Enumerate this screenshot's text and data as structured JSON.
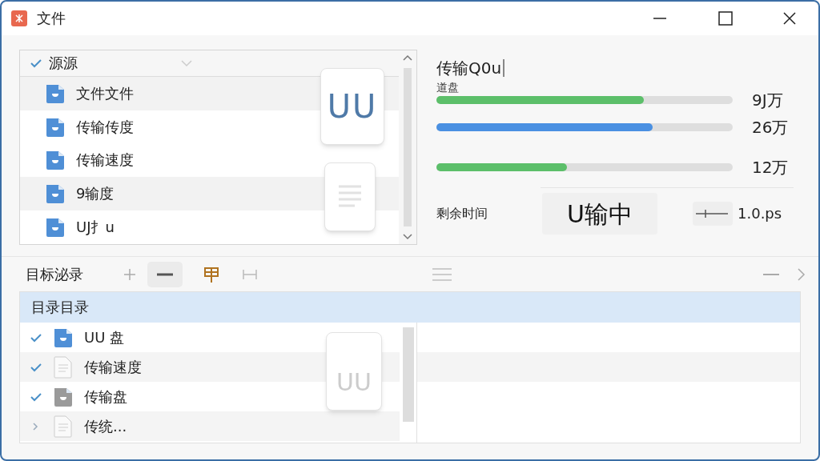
{
  "window": {
    "title": "文件"
  },
  "source_list": {
    "header": "源源",
    "header_checked": true,
    "items": [
      {
        "label": "文件文件",
        "kind": "folder"
      },
      {
        "label": "传输传度",
        "kind": "folder"
      },
      {
        "label": "传输速度",
        "kind": "folder"
      },
      {
        "label": "9输度",
        "kind": "folder"
      },
      {
        "label": "UJ扌u",
        "kind": "folder"
      }
    ],
    "floating_files": [
      {
        "kind": "letters",
        "text": "UU"
      },
      {
        "kind": "lines"
      }
    ]
  },
  "transfer": {
    "title": "传输Q0u",
    "bars": [
      {
        "label": "道盘",
        "level": 0.7,
        "reading": "9J万",
        "color": "#5cbf6a"
      },
      {
        "level": 0.73,
        "reading": "26万",
        "color": "#4a90e2"
      },
      {
        "level": 0.44,
        "reading": "12万",
        "color": "#5cbf6a"
      }
    ],
    "remaining_label": "剩余时间",
    "status": "U输中",
    "speed": "1.0.ps"
  },
  "target": {
    "label": "目标泌录",
    "header": "目录目录",
    "items": [
      {
        "label": "UU 盘",
        "kind": "folder",
        "checked": true
      },
      {
        "label": "传输速度",
        "kind": "document",
        "checked": true
      },
      {
        "label": "传输盘",
        "kind": "gray-folder",
        "checked": true
      },
      {
        "label": "传统...",
        "kind": "document",
        "checked": false
      }
    ],
    "floating_file": "UU"
  }
}
